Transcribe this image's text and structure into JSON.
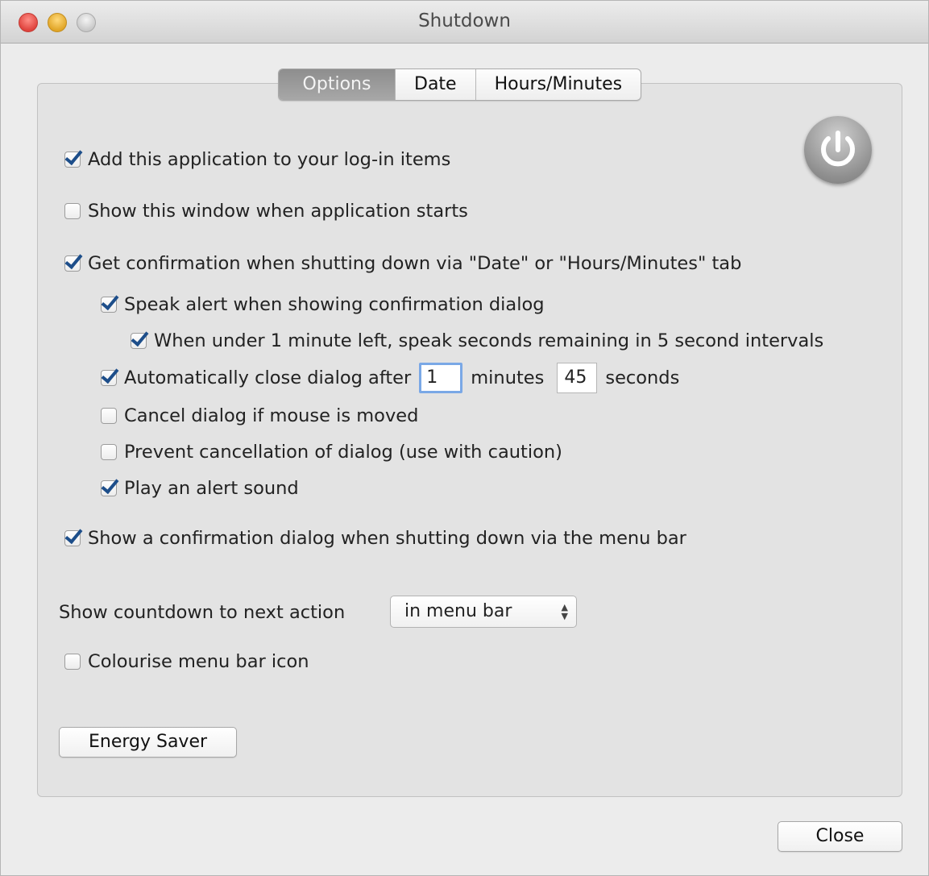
{
  "window": {
    "title": "Shutdown"
  },
  "tabs": [
    {
      "label": "Options",
      "active": true
    },
    {
      "label": "Date",
      "active": false
    },
    {
      "label": "Hours/Minutes",
      "active": false
    }
  ],
  "options": {
    "login_items": {
      "label": "Add this application to your log-in items",
      "checked": true
    },
    "show_window": {
      "label": "Show this window when application starts",
      "checked": false
    },
    "get_confirmation": {
      "label": "Get confirmation when shutting down via \"Date\" or \"Hours/Minutes\" tab",
      "checked": true
    },
    "speak_alert": {
      "label": "Speak alert when showing confirmation dialog",
      "checked": true
    },
    "speak_seconds": {
      "label": "When under 1 minute left, speak seconds remaining in 5 second intervals",
      "checked": true
    },
    "auto_close": {
      "label": "Automatically close dialog after",
      "checked": true,
      "minutes_value": "1",
      "minutes_label": "minutes",
      "seconds_value": "45",
      "seconds_label": "seconds"
    },
    "cancel_mouse": {
      "label": "Cancel dialog if mouse is moved",
      "checked": false
    },
    "prevent_cancel": {
      "label": "Prevent cancellation of dialog (use with caution)",
      "checked": false
    },
    "play_sound": {
      "label": "Play an alert sound",
      "checked": true
    },
    "menu_confirmation": {
      "label": "Show a confirmation dialog when shutting down via the menu bar",
      "checked": true
    },
    "countdown": {
      "label": "Show countdown to next action",
      "selected": "in menu bar"
    },
    "colourise": {
      "label": "Colourise menu bar icon",
      "checked": false
    }
  },
  "buttons": {
    "energy_saver": "Energy Saver",
    "close": "Close"
  },
  "icons": {
    "app_icon": "power-icon"
  },
  "colors": {
    "checkmark": "#1d4e8a",
    "focus_ring": "#7aa8e6"
  }
}
